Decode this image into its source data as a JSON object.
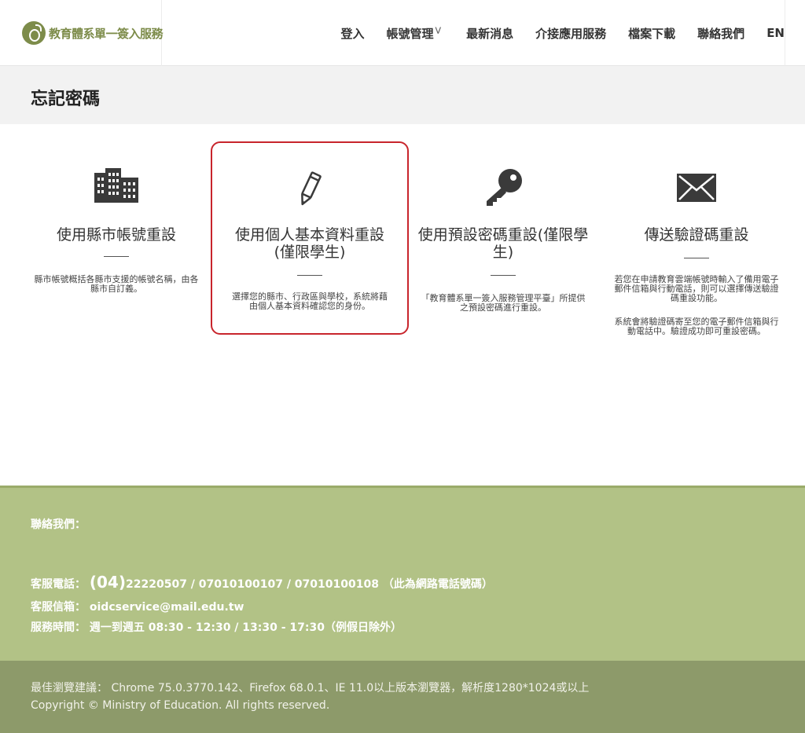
{
  "header": {
    "logo_text": "教育體系單一簽入服務",
    "nav": [
      {
        "label": "登入"
      },
      {
        "label": "帳號管理"
      },
      {
        "label": "最新消息"
      },
      {
        "label": "介接應用服務"
      },
      {
        "label": "檔案下載"
      },
      {
        "label": "聯絡我們"
      },
      {
        "label": "EN"
      }
    ]
  },
  "page": {
    "title": "忘記密碼"
  },
  "cards": [
    {
      "icon": "city-building-icon",
      "title": "使用縣市帳號重設",
      "desc": "縣市帳號概括各縣市支援的帳號名稱，由各縣市自訂義。"
    },
    {
      "icon": "pencil-icon",
      "title": "使用個人基本資料重設(僅限學生)",
      "desc": "選擇您的縣市、行政區與學校，系統將藉由個人基本資料確認您的身份。"
    },
    {
      "icon": "key-icon",
      "title": "使用預設密碼重設(僅限學生)",
      "desc": "「教育體系單一簽入服務管理平臺」所提供之預設密碼進行重設。"
    },
    {
      "icon": "envelope-icon",
      "title": "傳送驗證碼重設",
      "desc": "若您在申請教育雲端帳號時輸入了備用電子郵件信箱與行動電話，則可以選擇傳送驗證碼重設功能。",
      "desc2": "系統會將驗證碼寄至您的電子郵件信箱與行動電話中。驗證成功即可重設密碼。"
    }
  ],
  "footer": {
    "contact_heading": "聯絡我們：",
    "phone_label": "客服電話：",
    "phone_area": "(04)",
    "phone_numbers": "22220507 / 07010100107 / 07010100108 （此為網路電話號碼）",
    "email_label": "客服信箱：",
    "email": "oidcservice@mail.edu.tw",
    "hours_label": "服務時間：",
    "hours": "週一到週五 08:30 - 12:30 / 13:30 - 17:30（例假日除外）",
    "browser_note": "最佳瀏覽建議： Chrome 75.0.3770.142、Firefox 68.0.1、IE 11.0以上版本瀏覽器，解析度1280*1024或以上",
    "copyright": "Copyright © Ministry of Education. All rights reserved."
  }
}
